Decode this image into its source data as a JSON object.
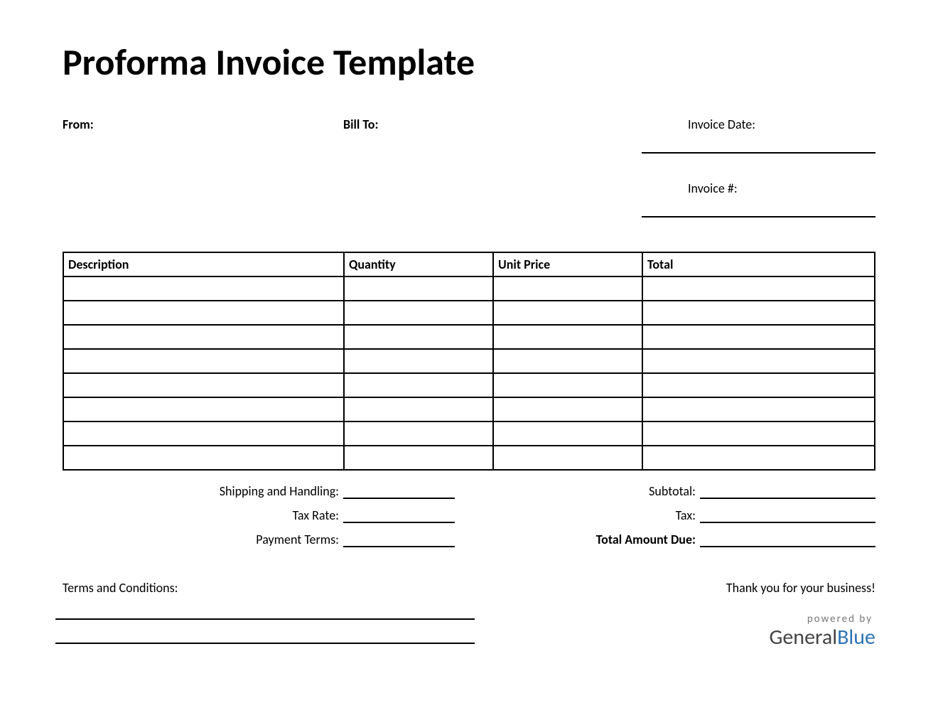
{
  "title": "Proforma Invoice Template",
  "header": {
    "from_label": "From:",
    "billto_label": "Bill To:",
    "invoice_date_label": "Invoice Date:",
    "invoice_number_label": "Invoice #:"
  },
  "table": {
    "columns": [
      "Description",
      "Quantity",
      "Unit Price",
      "Total"
    ],
    "row_count": 8
  },
  "summary_left": {
    "shipping_label": "Shipping and Handling:",
    "tax_rate_label": "Tax Rate:",
    "payment_terms_label": "Payment Terms:"
  },
  "summary_right": {
    "subtotal_label": "Subtotal:",
    "tax_label": "Tax:",
    "total_due_label": "Total Amount Due:"
  },
  "footer": {
    "terms_label": "Terms and Conditions:",
    "thanks": "Thank you for your business!",
    "powered": "powered by",
    "brand_general": "General",
    "brand_blue": "Blue"
  }
}
